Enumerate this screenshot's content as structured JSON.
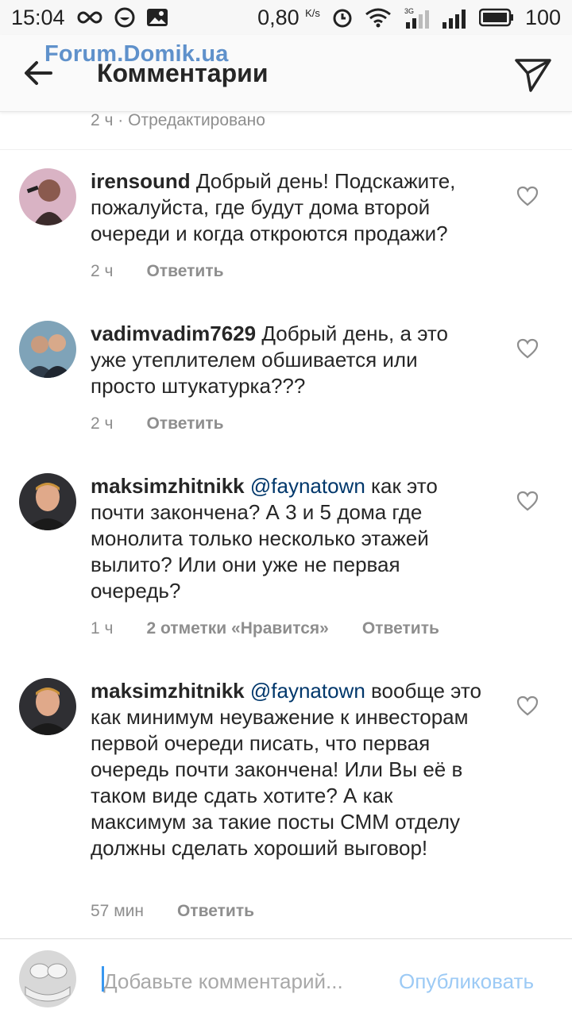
{
  "status_bar": {
    "time": "15:04",
    "speed_value": "0,80",
    "speed_unit": "K/s",
    "battery": "100"
  },
  "header": {
    "title": "Комментарии",
    "watermark": "Forum.Domik.ua"
  },
  "caption_meta": "2 ч · Отредактировано",
  "comments": [
    {
      "username": "irensound",
      "mention": "",
      "text": "Добрый день! Подскажите, пожалуйста, где будут дома второй очереди и когда откроются продажи?",
      "time": "2 ч",
      "likes": "",
      "reply": "Ответить"
    },
    {
      "username": "vadimvadim7629",
      "mention": "",
      "text": "Добрый день, а это уже утеплителем обшивается или просто штукатурка???",
      "time": "2 ч",
      "likes": "",
      "reply": "Ответить"
    },
    {
      "username": "maksimzhitnikk",
      "mention": "@faynatown",
      "text": "как это почти закончена? А 3 и 5 дома где монолита только несколько этажей вылито? Или они уже не первая очередь?",
      "time": "1 ч",
      "likes": "2 отметки «Нравится»",
      "reply": "Ответить"
    },
    {
      "username": "maksimzhitnikk",
      "mention": "@faynatown",
      "text": "вообще это как минимум неуважение к инвесторам первой очереди писать, что первая очередь почти закончена! Или Вы её в таком виде сдать хотите? А как максимум за такие посты СММ отделу должны сделать хороший выговор!",
      "time": "57 мин",
      "likes": "",
      "reply": "Ответить"
    }
  ],
  "composer": {
    "placeholder": "Добавьте комментарий...",
    "post_label": "Опубликовать"
  },
  "colors": {
    "mention": "#00376b",
    "meta": "#8e8e8e",
    "post_disabled": "#9ccaf5",
    "watermark": "#4f86c6"
  }
}
